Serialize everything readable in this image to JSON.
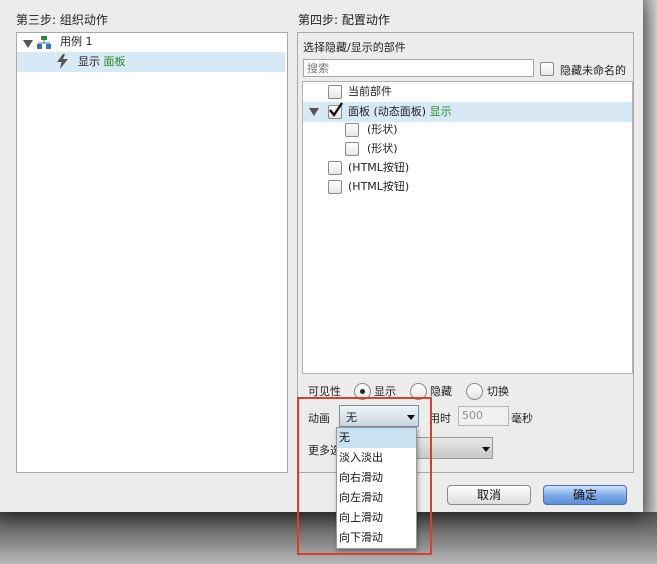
{
  "left": {
    "step_title": "第三步: 组织动作",
    "case_label": "用例 1",
    "action_prefix": "显示",
    "action_target": "面板"
  },
  "right": {
    "step_title": "第四步: 配置动作",
    "select_label": "选择隐藏/显示的部件",
    "search_placeholder": "搜索",
    "hide_unnamed_label": "隐藏未命名的",
    "tree": {
      "current": "当前部件",
      "panel_name": "面板 (动态面板)",
      "panel_action": "显示",
      "shape1": "(形状)",
      "shape2": "(形状)",
      "html_btn1": "(HTML按钮)",
      "html_btn2": "(HTML按钮)"
    },
    "visibility": {
      "label": "可见性",
      "show": "显示",
      "hide": "隐藏",
      "toggle": "切换",
      "selected": "显示"
    },
    "animation": {
      "label": "动画",
      "selected": "无",
      "duration_label": "用时",
      "duration_value": "500",
      "unit": "毫秒",
      "options": [
        "无",
        "淡入淡出",
        "向右滑动",
        "向左滑动",
        "向上滑动",
        "向下滑动"
      ]
    },
    "more_label": "更多选"
  },
  "buttons": {
    "cancel": "取消",
    "ok": "确定"
  }
}
